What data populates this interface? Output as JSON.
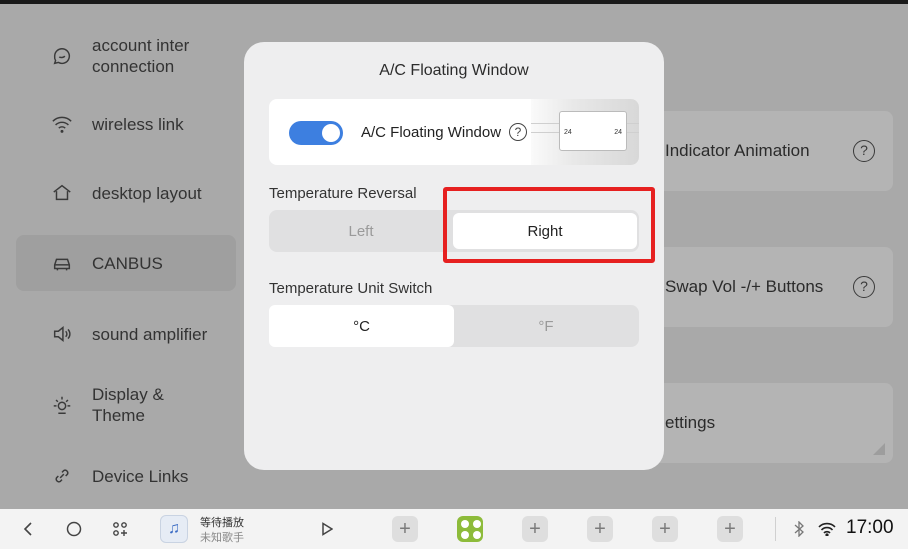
{
  "sidebar": {
    "items": [
      {
        "label": "account inter connection",
        "icon": "account-icon",
        "active": false
      },
      {
        "label": "wireless link",
        "icon": "wifi-icon",
        "active": false
      },
      {
        "label": "desktop layout",
        "icon": "home-icon",
        "active": false
      },
      {
        "label": "CANBUS",
        "icon": "car-icon",
        "active": true
      },
      {
        "label": "sound amplifier",
        "icon": "speaker-icon",
        "active": false
      },
      {
        "label": "Display & Theme",
        "icon": "sun-icon",
        "active": false
      },
      {
        "label": "Device Links",
        "icon": "link-icon",
        "active": false
      }
    ]
  },
  "background_cards": [
    {
      "label": "Indicator Animation",
      "help": "?"
    },
    {
      "label": "Swap Vol -/+ Buttons",
      "help": "?"
    },
    {
      "label": "ettings"
    }
  ],
  "modal": {
    "title": "A/C Floating Window",
    "floating_window": {
      "label": "A/C Floating Window",
      "enabled": true,
      "help": "?",
      "preview_left": "24",
      "preview_right": "24"
    },
    "temperature_reversal": {
      "label": "Temperature Reversal",
      "options": [
        "Left",
        "Right"
      ],
      "selected": "Right"
    },
    "temperature_unit": {
      "label": "Temperature Unit Switch",
      "options": [
        "°C",
        "°F"
      ],
      "selected": "°C"
    }
  },
  "taskbar": {
    "media_title": "等待播放",
    "media_artist": "未知歌手",
    "plus": "+",
    "time": "17:00"
  },
  "colors": {
    "accent": "#3d7fe0",
    "highlight": "#e62020",
    "app_green": "#8dbb3a"
  }
}
